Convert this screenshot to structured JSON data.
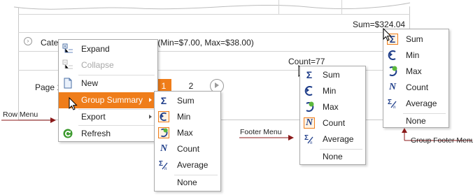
{
  "grid": {
    "group_sum": "Sum=$324.04",
    "group_row_prefix": "Cate",
    "group_row_suffix": "s (Min=$7.00, Max=$38.00)",
    "footer_count": "Count=77",
    "pager_label": "Page 1",
    "pager_pages": [
      "1",
      "2"
    ],
    "pager_active": "1"
  },
  "row_menu": {
    "items": [
      {
        "label": "Expand",
        "icon": "expand-icon"
      },
      {
        "label": "Collapse",
        "icon": "collapse-icon",
        "disabled": true
      },
      {
        "label": "New",
        "icon": "new-icon"
      },
      {
        "label": "Group Summary",
        "icon": "group-summary-icon",
        "submenu": true,
        "highlight": true
      },
      {
        "label": "Export",
        "icon": "export-icon",
        "submenu": true
      },
      {
        "label": "Refresh",
        "icon": "refresh-icon"
      }
    ]
  },
  "summary_items": [
    {
      "label": "Sum",
      "icon": "sum-icon"
    },
    {
      "label": "Min",
      "icon": "min-icon"
    },
    {
      "label": "Max",
      "icon": "max-icon"
    },
    {
      "label": "Count",
      "icon": "count-icon"
    },
    {
      "label": "Average",
      "icon": "average-icon"
    },
    {
      "label": "None",
      "icon": ""
    }
  ],
  "row_submenu": {
    "checked": [
      "Min",
      "Max"
    ]
  },
  "footer_menu": {
    "checked": [
      "Count"
    ]
  },
  "group_footer_menu": {
    "checked": [
      "Sum"
    ]
  },
  "captions": {
    "row_menu": "Row Menu",
    "footer_menu": "Footer Menu",
    "group_footer_menu": "Group Footer Menu"
  },
  "colors": {
    "accent": "#ef7d1a",
    "caption_line": "#8b1a1a"
  }
}
